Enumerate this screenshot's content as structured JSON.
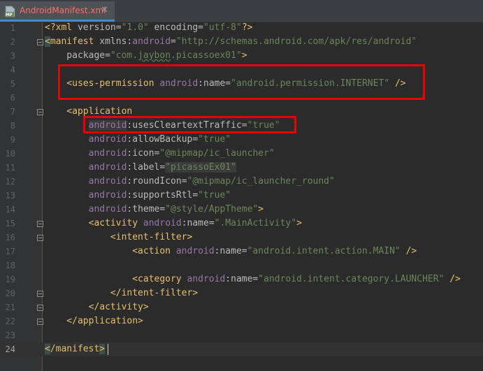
{
  "tab": {
    "title": "AndroidManifest.xml",
    "close": "✕",
    "icon": "manifest-file-icon",
    "badge": "MF"
  },
  "colors": {
    "tag": "#e8bf6a",
    "namespace": "#9876aa",
    "attribute": "#bababa",
    "value": "#6a8759",
    "highlight_box": "#e60000"
  },
  "lines": [
    {
      "n": "1",
      "parts": [
        [
          "decl",
          "<?xml "
        ],
        [
          "attr",
          "version="
        ],
        [
          "val",
          "\"1.0\""
        ],
        [
          "attr",
          " encoding="
        ],
        [
          "val",
          "\"utf-8\""
        ],
        [
          "decl",
          "?>"
        ]
      ]
    },
    {
      "n": "2",
      "parts": [
        [
          "hl-tag",
          "<"
        ],
        [
          "tag",
          "manifest "
        ],
        [
          "attr",
          "xmlns:"
        ],
        [
          "ns",
          "android"
        ],
        [
          "attr",
          "="
        ],
        [
          "val",
          "\"http://schemas.android.com/apk/res/android\""
        ]
      ]
    },
    {
      "n": "3",
      "parts": [
        [
          "attr",
          "    package="
        ],
        [
          "val",
          "\"com."
        ],
        [
          "val typo",
          "jaybon"
        ],
        [
          "val",
          ".picassoex01\""
        ],
        [
          "tag",
          ">"
        ]
      ]
    },
    {
      "n": "4",
      "parts": []
    },
    {
      "n": "5",
      "parts": [
        [
          "tag",
          "    <uses-permission "
        ],
        [
          "ns",
          "android"
        ],
        [
          "attr",
          ":name="
        ],
        [
          "val",
          "\"android.permission.INTERNET\""
        ],
        [
          "tag",
          " />"
        ]
      ]
    },
    {
      "n": "6",
      "parts": []
    },
    {
      "n": "7",
      "parts": [
        [
          "tag",
          "    <application"
        ]
      ]
    },
    {
      "n": "8",
      "parts": [
        [
          "attr",
          "        "
        ],
        [
          "ns hl-val",
          "android"
        ],
        [
          "attr",
          ":usesCleartextTraffic="
        ],
        [
          "val",
          "\"true\""
        ]
      ]
    },
    {
      "n": "9",
      "parts": [
        [
          "attr",
          "        "
        ],
        [
          "ns",
          "android"
        ],
        [
          "attr",
          ":allowBackup="
        ],
        [
          "val",
          "\"true\""
        ]
      ]
    },
    {
      "n": "10",
      "parts": [
        [
          "attr",
          "        "
        ],
        [
          "ns",
          "android"
        ],
        [
          "attr",
          ":icon="
        ],
        [
          "val",
          "\"@mipmap/ic_launcher\""
        ]
      ]
    },
    {
      "n": "11",
      "parts": [
        [
          "attr",
          "        "
        ],
        [
          "ns",
          "android"
        ],
        [
          "attr",
          ":label="
        ],
        [
          "val hl-val",
          "\"picassoEx01\""
        ]
      ]
    },
    {
      "n": "12",
      "parts": [
        [
          "attr",
          "        "
        ],
        [
          "ns",
          "android"
        ],
        [
          "attr",
          ":roundIcon="
        ],
        [
          "val",
          "\"@mipmap/ic_launcher_round\""
        ]
      ]
    },
    {
      "n": "13",
      "parts": [
        [
          "attr",
          "        "
        ],
        [
          "ns",
          "android"
        ],
        [
          "attr",
          ":supportsRtl="
        ],
        [
          "val",
          "\"true\""
        ]
      ]
    },
    {
      "n": "14",
      "parts": [
        [
          "attr",
          "        "
        ],
        [
          "ns",
          "android"
        ],
        [
          "attr",
          ":theme="
        ],
        [
          "val",
          "\"@style/AppTheme\""
        ],
        [
          "tag",
          ">"
        ]
      ]
    },
    {
      "n": "15",
      "parts": [
        [
          "tag",
          "        <activity "
        ],
        [
          "ns",
          "android"
        ],
        [
          "attr",
          ":name="
        ],
        [
          "val",
          "\".MainActivity\""
        ],
        [
          "tag",
          ">"
        ]
      ]
    },
    {
      "n": "16",
      "parts": [
        [
          "tag",
          "            <intent-filter>"
        ]
      ]
    },
    {
      "n": "17",
      "parts": [
        [
          "tag",
          "                <action "
        ],
        [
          "ns",
          "android"
        ],
        [
          "attr",
          ":name="
        ],
        [
          "val",
          "\"android.intent.action.MAIN\""
        ],
        [
          "tag",
          " />"
        ]
      ]
    },
    {
      "n": "18",
      "parts": []
    },
    {
      "n": "19",
      "parts": [
        [
          "tag",
          "                <category "
        ],
        [
          "ns",
          "android"
        ],
        [
          "attr",
          ":name="
        ],
        [
          "val",
          "\"android.intent.category.LAUNCHER\""
        ],
        [
          "tag",
          " />"
        ]
      ]
    },
    {
      "n": "20",
      "parts": [
        [
          "tag",
          "            </intent-filter>"
        ]
      ]
    },
    {
      "n": "21",
      "parts": [
        [
          "tag",
          "        </activity>"
        ]
      ]
    },
    {
      "n": "22",
      "parts": [
        [
          "tag",
          "    </application>"
        ]
      ]
    },
    {
      "n": "23",
      "parts": []
    },
    {
      "n": "24",
      "parts": [
        [
          "hl-tag",
          "<"
        ],
        [
          "tag",
          "/manifest"
        ],
        [
          "hl-tag",
          ">"
        ]
      ],
      "current": true
    }
  ]
}
